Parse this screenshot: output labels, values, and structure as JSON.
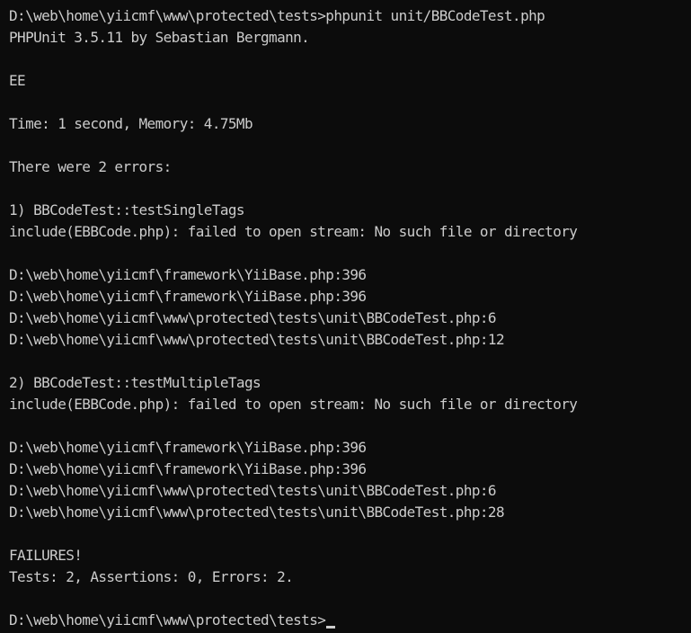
{
  "terminal": {
    "lines": [
      "D:\\web\\home\\yiicmf\\www\\protected\\tests>phpunit unit/BBCodeTest.php",
      "PHPUnit 3.5.11 by Sebastian Bergmann.",
      "",
      "EE",
      "",
      "Time: 1 second, Memory: 4.75Mb",
      "",
      "There were 2 errors:",
      "",
      "1) BBCodeTest::testSingleTags",
      "include(EBBCode.php): failed to open stream: No such file or directory",
      "",
      "D:\\web\\home\\yiicmf\\framework\\YiiBase.php:396",
      "D:\\web\\home\\yiicmf\\framework\\YiiBase.php:396",
      "D:\\web\\home\\yiicmf\\www\\protected\\tests\\unit\\BBCodeTest.php:6",
      "D:\\web\\home\\yiicmf\\www\\protected\\tests\\unit\\BBCodeTest.php:12",
      "",
      "2) BBCodeTest::testMultipleTags",
      "include(EBBCode.php): failed to open stream: No such file or directory",
      "",
      "D:\\web\\home\\yiicmf\\framework\\YiiBase.php:396",
      "D:\\web\\home\\yiicmf\\framework\\YiiBase.php:396",
      "D:\\web\\home\\yiicmf\\www\\protected\\tests\\unit\\BBCodeTest.php:6",
      "D:\\web\\home\\yiicmf\\www\\protected\\tests\\unit\\BBCodeTest.php:28",
      "",
      "FAILURES!",
      "Tests: 2, Assertions: 0, Errors: 2.",
      ""
    ],
    "prompt": "D:\\web\\home\\yiicmf\\www\\protected\\tests>",
    "colors": {
      "background": "#0c0c0c",
      "foreground": "#cccccc"
    }
  }
}
